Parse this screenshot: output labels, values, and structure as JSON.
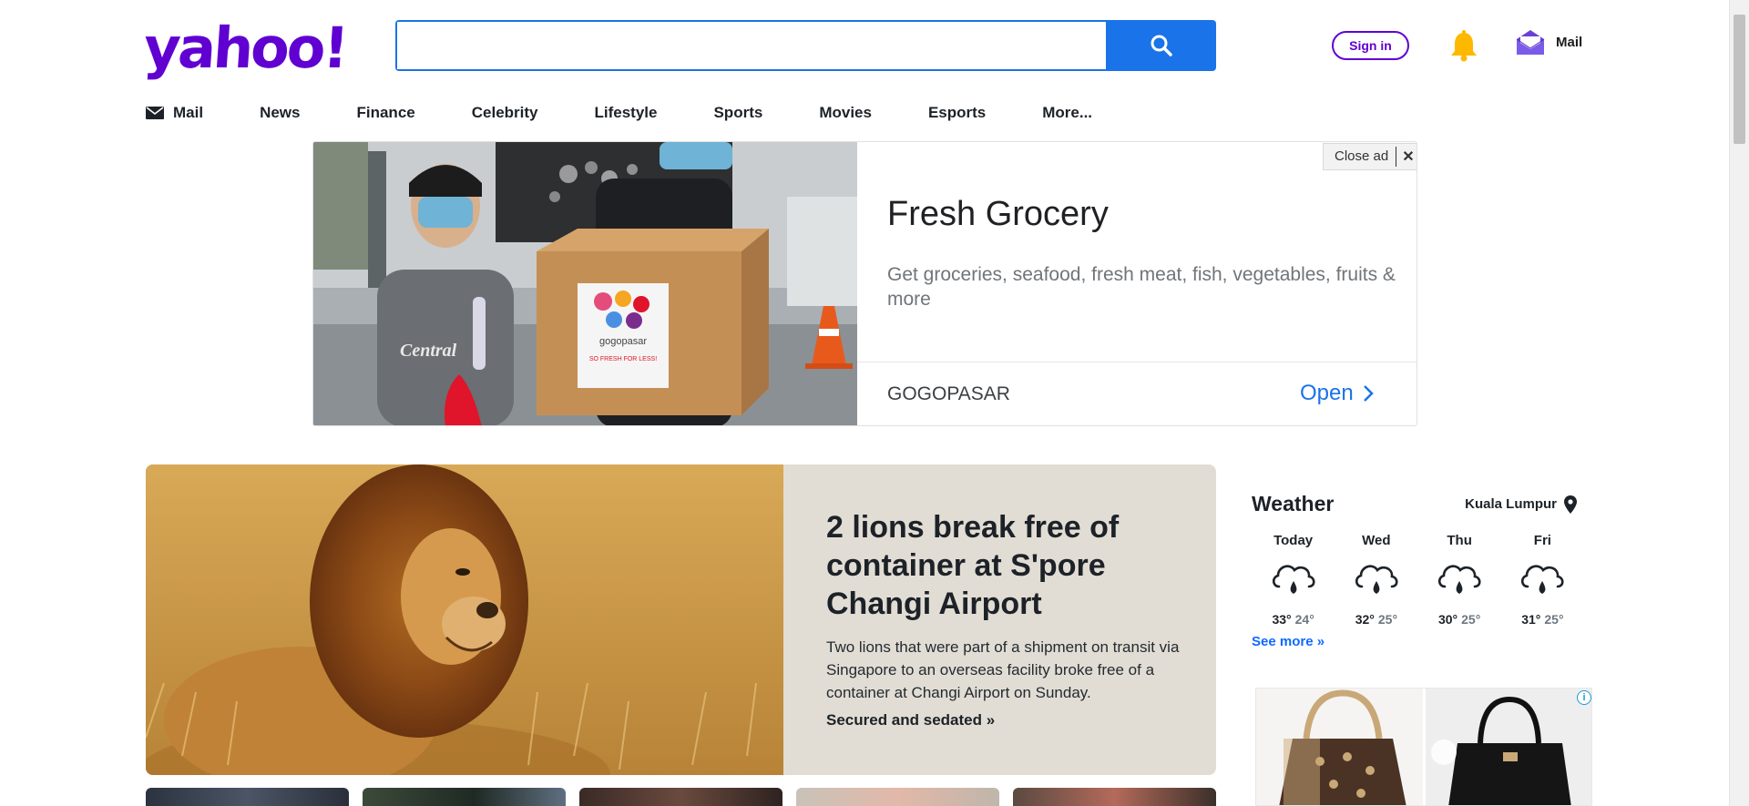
{
  "header": {
    "logo": "yahoo!",
    "search_placeholder": "",
    "sign_in": "Sign in",
    "mail_label": "Mail"
  },
  "nav": {
    "items": [
      "Mail",
      "News",
      "Finance",
      "Celebrity",
      "Lifestyle",
      "Sports",
      "Movies",
      "Esports",
      "More..."
    ]
  },
  "ad": {
    "title": "Fresh Grocery",
    "description": "Get groceries, seafood, fresh meat, fish, vegetables, fruits & more",
    "brand": "GOGOPASAR",
    "cta": "Open",
    "close_label": "Close ad",
    "close_x": "✕",
    "box_brand": "gogopasar",
    "box_tagline": "SO FRESH FOR LESS!",
    "shirt_text": "Central"
  },
  "hero": {
    "title": "2 lions break free of container at S'pore Changi Airport",
    "summary": "Two lions that were part of a shipment on transit via Singapore to an overseas facility broke free of a container at Changi Airport on Sunday.",
    "link": "Secured and sedated »"
  },
  "weather": {
    "title": "Weather",
    "location": "Kuala Lumpur",
    "days": [
      {
        "name": "Today",
        "hi": "33°",
        "lo": "24°",
        "icon": "rain-cloud-icon"
      },
      {
        "name": "Wed",
        "hi": "32°",
        "lo": "25°",
        "icon": "rain-cloud-icon"
      },
      {
        "name": "Thu",
        "hi": "30°",
        "lo": "25°",
        "icon": "rain-cloud-icon"
      },
      {
        "name": "Fri",
        "hi": "31°",
        "lo": "25°",
        "icon": "rain-cloud-icon"
      }
    ],
    "see_more": "See more »"
  },
  "colors": {
    "brand_purple": "#6001d2",
    "search_blue": "#1a73e8",
    "link_blue": "#0f69ff",
    "bell_yellow": "#ffb800"
  }
}
